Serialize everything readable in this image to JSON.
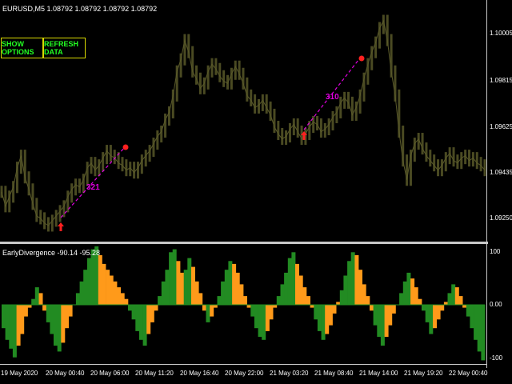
{
  "chart_header": {
    "symbol_text": "EURUSD,M5  1.08792 1.08792 1.08792 1.08792"
  },
  "buttons": {
    "show_options": "SHOW OPTIONS",
    "refresh_data": "REFRESH DATA"
  },
  "indicator": {
    "title": "EarlyDivergence -90.14 -95.28"
  },
  "price_axis": [
    "1.10005",
    "1.09815",
    "1.09625",
    "1.09435",
    "1.09250"
  ],
  "indicator_axis": [
    "100",
    "0.00",
    "-100"
  ],
  "time_axis": [
    "19 May 2020",
    "20 May 00:40",
    "20 May 06:00",
    "20 May 11:20",
    "20 May 16:40",
    "20 May 22:00",
    "21 May 03:20",
    "21 May 08:40",
    "21 May 14:00",
    "21 May 19:20",
    "22 May 00:40"
  ],
  "annotations": {
    "div1": "321",
    "div2": "310"
  },
  "colors": {
    "candles": "#4a4a22",
    "div_line": "#e000e0",
    "arrow": "#ff2020",
    "hist_pos": "#228b22",
    "hist_neg": "#ff9a1a"
  },
  "chart_data": {
    "type": "line",
    "ylim": [
      1.0915,
      1.101
    ],
    "price_ticks": [
      1.10005,
      1.09815,
      1.09625,
      1.09435,
      1.0925
    ],
    "series": [
      {
        "values": [
          1.0935,
          1.0929,
          1.0933,
          1.0937,
          1.0945,
          1.095,
          1.0941,
          1.0936,
          1.093,
          1.0925,
          1.0924,
          1.0922,
          1.0921,
          1.0923,
          1.0925,
          1.0927,
          1.0929,
          1.0933,
          1.0936,
          1.0938,
          1.0937,
          1.094,
          1.0945,
          1.0947,
          1.0944,
          1.0946,
          1.0949,
          1.0952,
          1.095,
          1.0949,
          1.0947,
          1.0946,
          1.0944,
          1.0945,
          1.0943,
          1.0945,
          1.0948,
          1.095,
          1.0952,
          1.0955,
          1.0958,
          1.096,
          1.0965,
          1.0968,
          1.0975,
          1.0985,
          1.099,
          1.0998,
          1.0993,
          1.0985,
          1.0982,
          1.0978,
          1.098,
          1.0985,
          1.0988,
          1.0986,
          1.0983,
          1.0981,
          1.098,
          1.0984,
          1.0987,
          1.0984,
          1.098,
          1.0975,
          1.0973,
          1.097,
          1.0971,
          1.0973,
          1.097,
          1.0967,
          1.0962,
          1.0959,
          1.0957,
          1.0958,
          1.0961,
          1.0963,
          1.096,
          1.0957,
          1.0959,
          1.0962,
          1.0964,
          1.0963,
          1.096,
          1.0961,
          1.0963,
          1.0966,
          1.0968,
          1.0972,
          1.0974,
          1.0972,
          1.0967,
          1.097,
          1.0975,
          1.0982,
          1.0988,
          1.0993,
          1.0997,
          1.1003,
          1.1006,
          1.0998,
          1.0985,
          1.0975,
          1.096,
          1.0948,
          1.094,
          1.095,
          1.0955,
          1.0957,
          1.0953,
          1.095,
          1.0948,
          1.0946,
          1.0944,
          1.0946,
          1.0949,
          1.0951,
          1.0948,
          1.0947,
          1.0949,
          1.095,
          1.0948,
          1.0949,
          1.0947,
          1.0946,
          1.0944
        ]
      }
    ],
    "indicator_ylim": [
      -100,
      100
    ],
    "indicator_histogram": [
      -40,
      -60,
      -75,
      -90,
      -70,
      -50,
      -20,
      -5,
      10,
      30,
      20,
      -10,
      -30,
      -50,
      -70,
      -80,
      -65,
      -40,
      -20,
      0,
      20,
      40,
      60,
      80,
      95,
      100,
      85,
      70,
      60,
      50,
      40,
      30,
      20,
      10,
      -10,
      -25,
      -45,
      -60,
      -70,
      -50,
      -30,
      -10,
      15,
      40,
      60,
      90,
      95,
      75,
      55,
      60,
      80,
      65,
      40,
      20,
      -10,
      -30,
      -20,
      -5,
      15,
      40,
      60,
      75,
      70,
      55,
      35,
      15,
      -5,
      -20,
      -40,
      -55,
      -60,
      -45,
      -25,
      -5,
      15,
      35,
      55,
      80,
      90,
      70,
      50,
      30,
      15,
      -5,
      -25,
      -45,
      -60,
      -50,
      -35,
      -15,
      5,
      25,
      50,
      75,
      90,
      85,
      60,
      35,
      15,
      -10,
      -35,
      -55,
      -70,
      -55,
      -35,
      -15,
      0,
      20,
      40,
      55,
      45,
      30,
      10,
      -10,
      -30,
      -50,
      -40,
      -25,
      -10,
      5,
      20,
      35,
      30,
      15,
      -5,
      -20,
      -40,
      -60,
      -80,
      -95
    ]
  }
}
